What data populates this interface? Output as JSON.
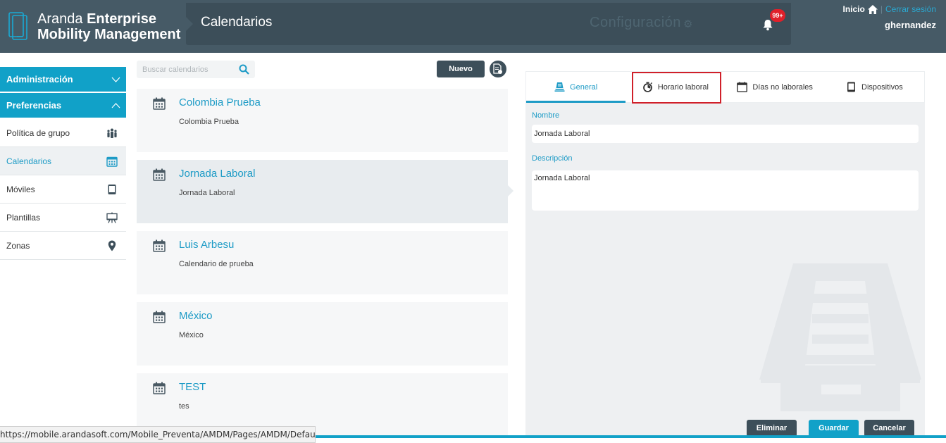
{
  "app": {
    "brand_light": "Aranda",
    "brand_bold_1": "Enterprise",
    "brand_bold_2": "Mobility Management",
    "page_title": "Calendarios",
    "config_label": "Configuración",
    "notification_count": "99+",
    "inicio": "Inicio",
    "separator": "|",
    "cerrar_sesion": "Cerrar sesión",
    "username": "ghernandez"
  },
  "sidebar": {
    "groups": [
      {
        "label": "Administración",
        "expanded": false
      },
      {
        "label": "Preferencias",
        "expanded": true
      }
    ],
    "items": [
      {
        "label": "Política de grupo",
        "icon": "group-icon"
      },
      {
        "label": "Calendarios",
        "icon": "calendar-icon",
        "active": true
      },
      {
        "label": "Móviles",
        "icon": "tablet-icon"
      },
      {
        "label": "Plantillas",
        "icon": "easel-icon"
      },
      {
        "label": "Zonas",
        "icon": "map-pin-icon"
      }
    ]
  },
  "list": {
    "search_placeholder": "Buscar calendarios",
    "new_button": "Nuevo",
    "items": [
      {
        "name": "Colombia Prueba",
        "description": "Colombia Prueba"
      },
      {
        "name": "Jornada Laboral",
        "description": "Jornada Laboral",
        "selected": true
      },
      {
        "name": "Luis Arbesu",
        "description": "Calendario de prueba"
      },
      {
        "name": "México",
        "description": "México"
      },
      {
        "name": "TEST",
        "description": "tes"
      }
    ]
  },
  "detail": {
    "tabs": [
      {
        "label": "General",
        "icon": "stack-icon",
        "active": true
      },
      {
        "label": "Horario laboral",
        "icon": "stopwatch-icon"
      },
      {
        "label": "Días no laborales",
        "icon": "calendar-icon"
      },
      {
        "label": "Dispositivos",
        "icon": "tablet-icon"
      }
    ],
    "nombre_label": "Nombre",
    "nombre_value": "Jornada Laboral",
    "descripcion_label": "Descripción",
    "descripcion_value": "Jornada Laboral",
    "buttons": {
      "delete": "Eliminar",
      "save": "Guardar",
      "cancel": "Cancelar"
    }
  },
  "status_bar": {
    "url": "https://mobile.arandasoft.com/Mobile_Preventa/AMDM/Pages/AMDM/Default.asp..."
  },
  "colors": {
    "header": "#465a66",
    "accent": "#11a1c8",
    "highlight": "#d0202a"
  }
}
